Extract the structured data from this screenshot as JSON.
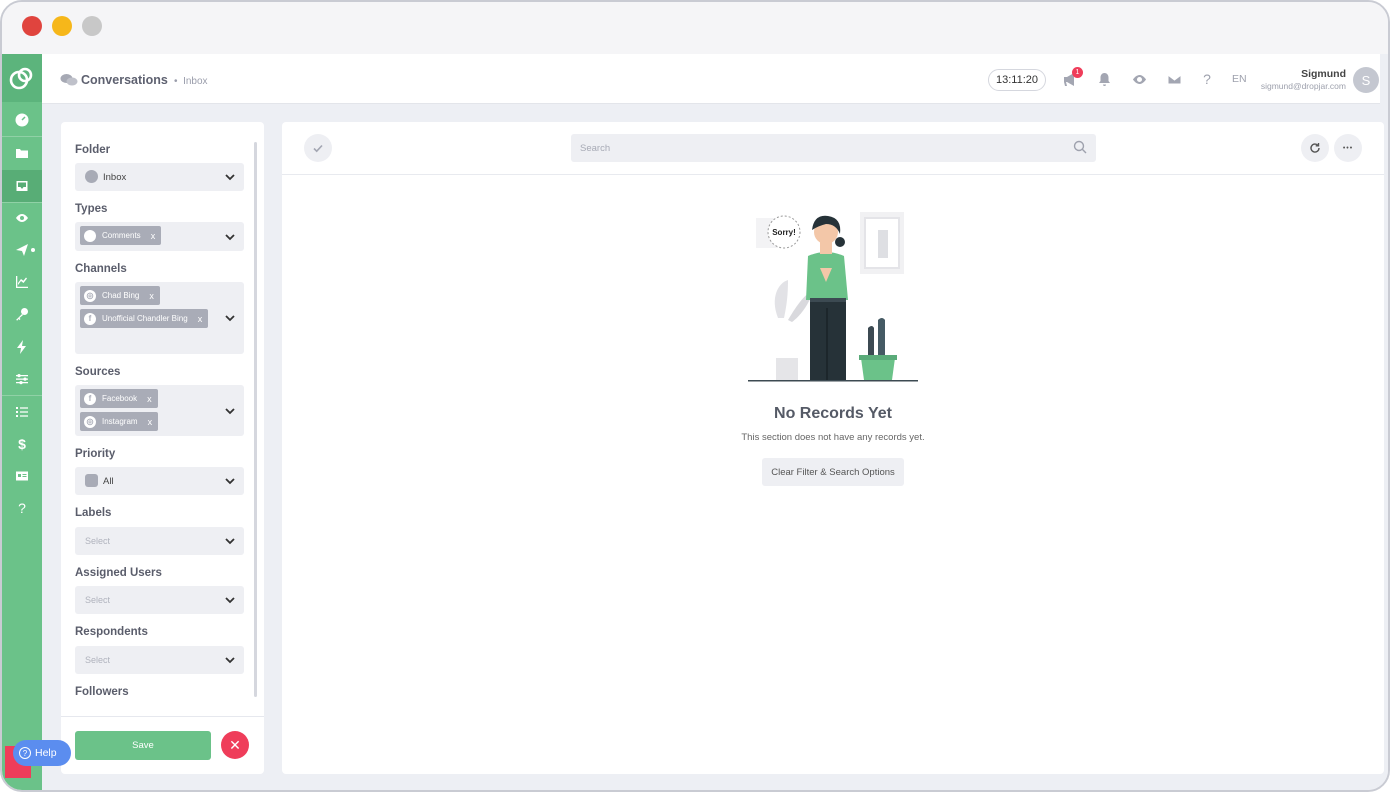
{
  "window": {
    "controls": [
      "close",
      "minimize",
      "maximize"
    ]
  },
  "sidebar": {
    "logo": "dropjar-logo",
    "items": [
      {
        "icon": "dashboard-icon",
        "active": false
      },
      {
        "icon": "folder-icon",
        "active": false
      },
      {
        "icon": "inbox-icon",
        "active": true
      },
      {
        "icon": "eye-icon",
        "active": false
      },
      {
        "icon": "send-icon",
        "active": false
      },
      {
        "icon": "chart-icon",
        "active": false
      },
      {
        "icon": "key-icon",
        "active": false
      },
      {
        "icon": "bolt-icon",
        "active": false
      },
      {
        "icon": "sliders-icon",
        "active": false
      },
      {
        "icon": "list-icon",
        "active": false
      },
      {
        "icon": "dollar-icon",
        "active": false
      },
      {
        "icon": "id-card-icon",
        "active": false
      },
      {
        "icon": "question-icon",
        "active": false
      }
    ],
    "dollar_glyph": "$",
    "question_glyph": "?"
  },
  "header": {
    "title": "Conversations",
    "breadcrumb": "Inbox",
    "clock": "13:11:20",
    "notification_count": "1",
    "help_glyph": "?",
    "language": "EN",
    "user": {
      "name": "Sigmund",
      "email": "sigmund@dropjar.com",
      "initial": "S"
    }
  },
  "filters": {
    "folder": {
      "label": "Folder",
      "value": "Inbox"
    },
    "types": {
      "label": "Types",
      "chips": [
        {
          "text": "Comments"
        }
      ]
    },
    "channels": {
      "label": "Channels",
      "chips": [
        {
          "text": "Chad Bing",
          "icon": "instagram-icon"
        },
        {
          "text": "Unofficial Chandler Bing",
          "icon": "facebook-icon"
        }
      ]
    },
    "sources": {
      "label": "Sources",
      "chips": [
        {
          "text": "Facebook",
          "icon": "facebook-icon"
        },
        {
          "text": "Instagram",
          "icon": "instagram-icon"
        }
      ]
    },
    "priority": {
      "label": "Priority",
      "value": "All"
    },
    "labels": {
      "label": "Labels",
      "placeholder": "Select"
    },
    "assigned_users": {
      "label": "Assigned Users",
      "placeholder": "Select"
    },
    "respondents": {
      "label": "Respondents",
      "placeholder": "Select"
    },
    "followers": {
      "label": "Followers"
    },
    "chip_remove": "x",
    "fb_glyph": "f",
    "save_label": "Save",
    "close_glyph": "✕"
  },
  "help": {
    "label": "Help",
    "glyph": "?"
  },
  "main": {
    "search_placeholder": "Search",
    "more_glyph": "•••",
    "empty": {
      "bubble": "Sorry!",
      "title": "No Records Yet",
      "text": "This section does not have any records yet.",
      "button": "Clear Filter & Search Options"
    }
  },
  "colors": {
    "brand_green": "#6bc289",
    "danger": "#ef3d5a",
    "help_blue": "#5b8def"
  }
}
